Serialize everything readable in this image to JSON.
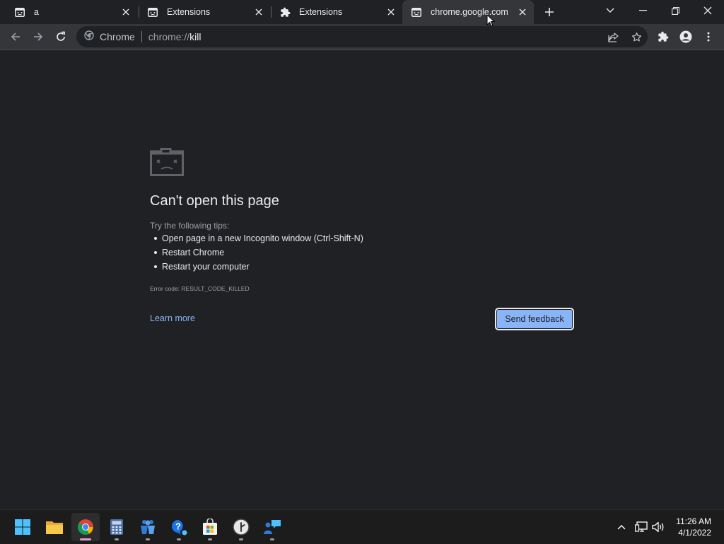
{
  "tabs": [
    {
      "label": "a",
      "icon": "sad-page-icon",
      "active": false
    },
    {
      "label": "Extensions",
      "icon": "sad-page-icon",
      "active": false
    },
    {
      "label": "Extensions",
      "icon": "puzzle-icon",
      "active": false
    },
    {
      "label": "chrome.google.com",
      "icon": "sad-page-icon",
      "active": true
    }
  ],
  "omnibox": {
    "chip_label": "Chrome",
    "url_prefix": "chrome://",
    "url_host": "kill"
  },
  "error_page": {
    "title": "Can't open this page",
    "tips_heading": "Try the following tips:",
    "tips": [
      "Open page in a new Incognito window (Ctrl-Shift-N)",
      "Restart Chrome",
      "Restart your computer"
    ],
    "error_code": "Error code: RESULT_CODE_KILLED",
    "learn_more": "Learn more",
    "send_feedback": "Send feedback"
  },
  "taskbar": {
    "apps": [
      "start-icon",
      "file-explorer-icon",
      "chrome-icon",
      "calculator-icon",
      "teams-icon",
      "get-help-icon",
      "microsoft-store-icon",
      "clock-icon",
      "feedback-hub-icon"
    ],
    "time": "11:26 AM",
    "date": "4/1/2022"
  },
  "colors": {
    "accent": "#8ab4f8",
    "background": "#202124",
    "toolbar": "#35363a"
  }
}
